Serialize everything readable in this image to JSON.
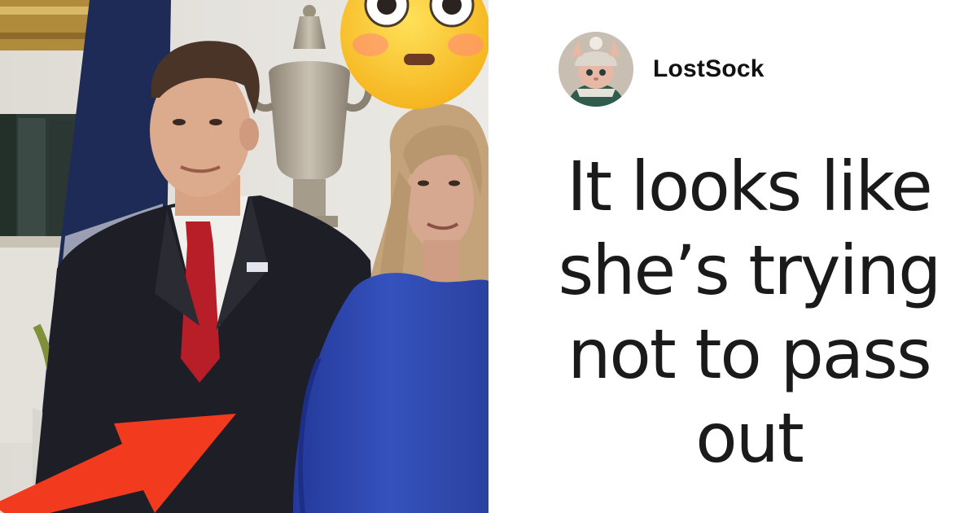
{
  "post": {
    "author": {
      "name": "LostSock",
      "avatar_icon": "hairless-cat-in-knit-hat-avatar"
    },
    "quote_lines": [
      "It looks like",
      "she’s trying",
      "not to pass",
      "out"
    ]
  },
  "photo": {
    "emoji_icon": "flushed-face-emoji",
    "annotation_icon": "red-arrow-icon",
    "colors": {
      "arrow": "#f23a1e",
      "dress": "#2f4bb0",
      "tie": "#c0202a",
      "suit": "#1c1d24"
    }
  }
}
